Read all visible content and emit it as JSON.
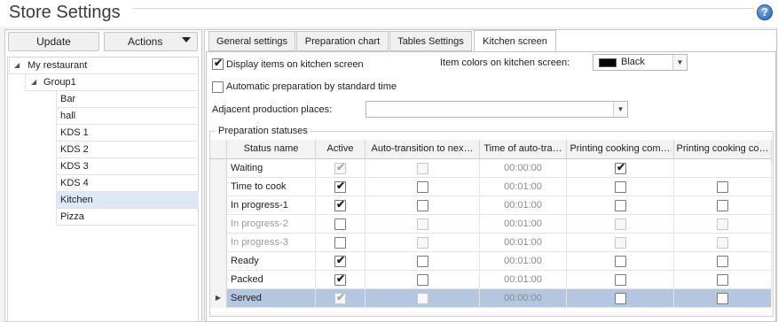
{
  "window": {
    "title": "Store Settings",
    "help_icon": "?"
  },
  "left": {
    "update_label": "Update",
    "actions_label": "Actions",
    "tree": [
      {
        "label": "My restaurant",
        "level": 0,
        "expanded": true
      },
      {
        "label": "Group1",
        "level": 1,
        "expanded": true
      },
      {
        "label": "Bar",
        "level": 2
      },
      {
        "label": "hall",
        "level": 2
      },
      {
        "label": "KDS 1",
        "level": 2
      },
      {
        "label": "KDS 2",
        "level": 2
      },
      {
        "label": "KDS 3",
        "level": 2
      },
      {
        "label": "KDS 4",
        "level": 2
      },
      {
        "label": "Kitchen",
        "level": 2,
        "selected": true
      },
      {
        "label": "Pizza",
        "level": 2
      }
    ]
  },
  "tabs": [
    {
      "label": "General settings"
    },
    {
      "label": "Preparation chart"
    },
    {
      "label": "Tables Settings"
    },
    {
      "label": "Kitchen screen",
      "active": true
    }
  ],
  "kitchen": {
    "display_items_label": "Display items on kitchen screen",
    "display_items_checked": true,
    "item_colors_label": "Item colors on kitchen screen:",
    "item_color_value": "Black",
    "item_color_swatch": "#000000",
    "auto_prep_label": "Automatic preparation by standard time",
    "auto_prep_checked": false,
    "adjacent_label": "Adjacent production places:",
    "adjacent_value": ""
  },
  "statuses": {
    "group_title": "Preparation statuses",
    "columns": [
      "Status name",
      "Active",
      "Auto-transition to nex…",
      "Time of auto-tra…",
      "Printing cooking com…",
      "Printing cooking co…"
    ],
    "rows": [
      {
        "name": "Waiting",
        "active": true,
        "active_disabled": true,
        "auto": false,
        "auto_disabled": true,
        "time": "00:00:00",
        "print1": true,
        "print2": null,
        "dim": false
      },
      {
        "name": "Time to cook",
        "active": true,
        "active_disabled": false,
        "auto": false,
        "auto_disabled": false,
        "time": "00:01:00",
        "print1": false,
        "print2": false,
        "dim": false
      },
      {
        "name": "In progress-1",
        "active": true,
        "active_disabled": false,
        "auto": false,
        "auto_disabled": false,
        "time": "00:01:00",
        "print1": false,
        "print2": false,
        "dim": false
      },
      {
        "name": "In progress-2",
        "active": false,
        "active_disabled": false,
        "auto": false,
        "auto_disabled": true,
        "time": "00:01:00",
        "print1": false,
        "print2": false,
        "print_disabled": true,
        "dim": true
      },
      {
        "name": "In progress-3",
        "active": false,
        "active_disabled": false,
        "auto": false,
        "auto_disabled": true,
        "time": "00:01:00",
        "print1": false,
        "print2": false,
        "print_disabled": true,
        "dim": true
      },
      {
        "name": "Ready",
        "active": true,
        "active_disabled": false,
        "auto": false,
        "auto_disabled": false,
        "time": "00:01:00",
        "print1": false,
        "print2": false,
        "dim": false
      },
      {
        "name": "Packed",
        "active": true,
        "active_disabled": false,
        "auto": false,
        "auto_disabled": false,
        "time": "00:01:00",
        "print1": false,
        "print2": false,
        "dim": false
      },
      {
        "name": "Served",
        "active": true,
        "active_disabled": true,
        "auto": false,
        "auto_disabled": true,
        "time": "00:00:00",
        "print1": false,
        "print2": false,
        "dim": false,
        "selected": true
      }
    ]
  }
}
